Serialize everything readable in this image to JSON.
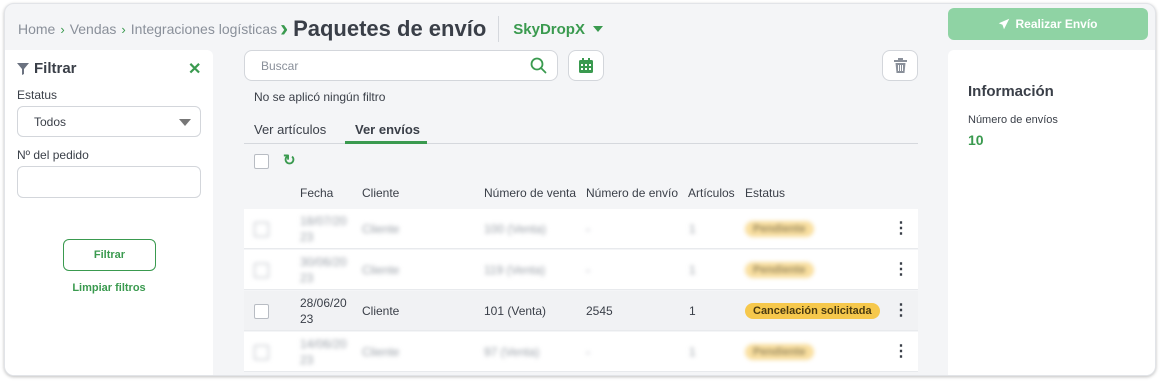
{
  "breadcrumb": {
    "items": [
      "Home",
      "Vendas",
      "Integraciones logísticas"
    ],
    "title": "Paquetes de envío",
    "brand": "SkyDropX"
  },
  "actions": {
    "realizar_envio": "Realizar Envío"
  },
  "filter": {
    "title": "Filtrar",
    "estatus_label": "Estatus",
    "estatus_value": "Todos",
    "pedido_label": "Nº del pedido",
    "pedido_value": "",
    "filtrar_button": "Filtrar",
    "clear_link": "Limpiar filtros"
  },
  "search": {
    "placeholder": "Buscar",
    "no_filter": "No se aplicó ningún filtro"
  },
  "tabs": [
    {
      "label": "Ver artículos",
      "active": false
    },
    {
      "label": "Ver envíos",
      "active": true
    }
  ],
  "table": {
    "headers": [
      "Fecha",
      "Cliente",
      "Número de venta",
      "Número de envío",
      "Artículos",
      "Estatus"
    ],
    "rows": [
      {
        "fecha1": "18/07/20",
        "fecha2": "23",
        "cliente": "Cliente",
        "venta": "100 (Venta)",
        "envio": "-",
        "articulos": "1",
        "estatus": "Pendiente",
        "blurred": true
      },
      {
        "fecha1": "30/06/20",
        "fecha2": "23",
        "cliente": "Cliente",
        "venta": "119 (Venta)",
        "envio": "-",
        "articulos": "1",
        "estatus": "Pendiente",
        "blurred": true
      },
      {
        "fecha1": "28/06/20",
        "fecha2": "23",
        "cliente": "Cliente",
        "venta": "101 (Venta)",
        "envio": "2545",
        "articulos": "1",
        "estatus": "Cancelación solicitada",
        "blurred": false
      },
      {
        "fecha1": "14/06/20",
        "fecha2": "23",
        "cliente": "Cliente",
        "venta": "97 (Venta)",
        "envio": "-",
        "articulos": "1",
        "estatus": "Pendiente",
        "blurred": true
      }
    ]
  },
  "info": {
    "title": "Información",
    "envios_label": "Número de envíos",
    "envios_value": "10"
  },
  "colors": {
    "accent": "#3a9a4f",
    "button_disabled": "#8fd3a4",
    "badge": "#f6c84c"
  }
}
